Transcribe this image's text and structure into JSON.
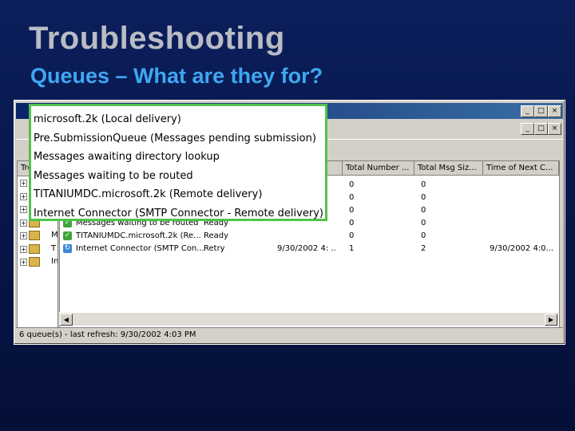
{
  "slide": {
    "title": "Troubleshooting",
    "subtitle": "Queues – What are they for?"
  },
  "window": {
    "title_controls": [
      "_",
      "□",
      "×"
    ],
    "tree_header": "Tre",
    "tree_rows": [
      "M",
      "T",
      "In"
    ],
    "columns": [
      "Total Number ...",
      "Total Msg Siz...",
      "Time of Next C..."
    ],
    "rows": [
      {
        "name": "",
        "state": "",
        "submit": "",
        "total_number": "0",
        "total_size": "0",
        "next_time": ""
      },
      {
        "name": "",
        "state": "",
        "submit": "",
        "total_number": "0",
        "total_size": "0",
        "next_time": ""
      },
      {
        "name": "",
        "state": "",
        "submit": "",
        "total_number": "0",
        "total_size": "0",
        "next_time": ""
      },
      {
        "name": "Messages waiting to be routed",
        "state": "Ready",
        "submit": "",
        "total_number": "0",
        "total_size": "0",
        "next_time": ""
      },
      {
        "name": "TITANIUMDC.microsoft.2k (Re...",
        "state": "Ready",
        "submit": "",
        "total_number": "0",
        "total_size": "0",
        "next_time": ""
      },
      {
        "name": "Internet Connector (SMTP Con...",
        "state": "Retry",
        "submit": "9/30/2002 4: ..",
        "total_number": "1",
        "total_size": "2",
        "next_time": "9/30/2002 4:0..."
      }
    ],
    "status": "6 queue(s) - last refresh: 9/30/2002 4:03 PM"
  },
  "callout": {
    "items": [
      "microsoft.2k (Local delivery)",
      "Pre.SubmissionQueue (Messages pending submission)",
      "Messages awaiting directory lookup",
      "Messages waiting to be routed",
      "TITANIUMDC.microsoft.2k (Remote delivery)",
      "Internet Connector (SMTP Connector - Remote delivery)"
    ]
  }
}
